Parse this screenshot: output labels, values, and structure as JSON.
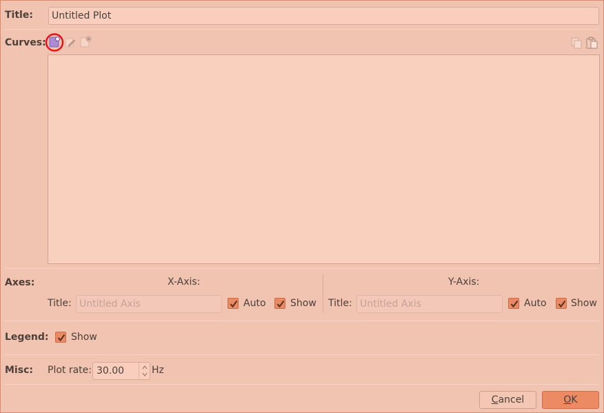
{
  "title_row": {
    "label": "Title:",
    "value": "Untitled Plot"
  },
  "curves": {
    "label": "Curves:",
    "toolbar_icons": [
      "add-curve-icon",
      "edit-curve-icon",
      "remove-curve-icon",
      "copy-icon",
      "paste-icon"
    ],
    "items": []
  },
  "axes": {
    "label": "Axes:",
    "x": {
      "heading": "X-Axis:",
      "title_label": "Title:",
      "title_placeholder": "Untitled Axis",
      "auto_label": "Auto",
      "auto_checked": true,
      "show_label": "Show",
      "show_checked": true
    },
    "y": {
      "heading": "Y-Axis:",
      "title_label": "Title:",
      "title_placeholder": "Untitled Axis",
      "auto_label": "Auto",
      "auto_checked": true,
      "show_label": "Show",
      "show_checked": true
    }
  },
  "legend": {
    "label": "Legend:",
    "show_label": "Show",
    "show_checked": true
  },
  "misc": {
    "label": "Misc:",
    "plot_rate_label": "Plot rate:",
    "plot_rate_value": "30.00",
    "unit": "Hz"
  },
  "buttons": {
    "cancel_prefix": "C",
    "cancel_rest": "ancel",
    "ok_prefix": "O",
    "ok_rest": "K"
  },
  "colors": {
    "background": "#f1c3b1",
    "accent": "#e88a63",
    "highlight_ring": "#e0141a"
  }
}
